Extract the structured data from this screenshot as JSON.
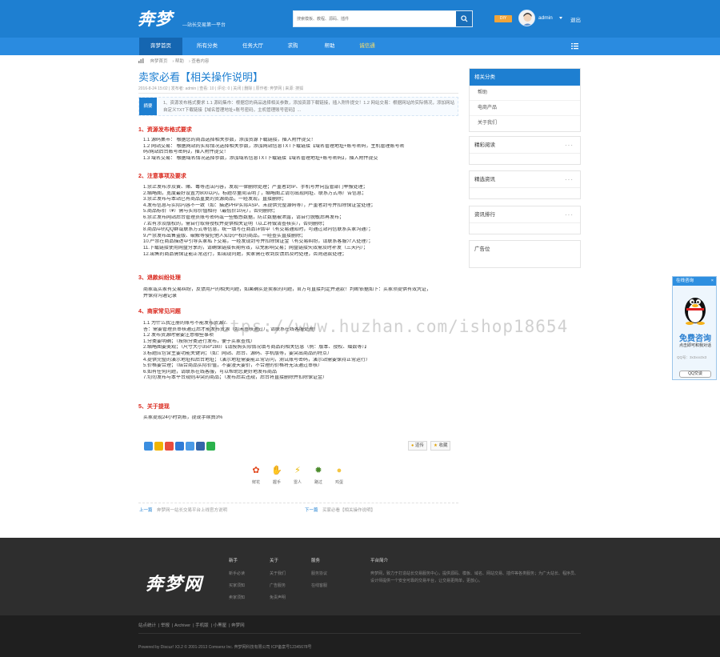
{
  "header": {
    "logo_text": "奔梦",
    "slogan": "—站长交易第一平台",
    "search_placeholder": "搜索模板、教程、源码、插件",
    "diy_badge": "DIY",
    "username": "admin",
    "logout": "退出"
  },
  "nav": {
    "items": [
      "奔梦首页",
      "所有分类",
      "任务大厅",
      "求购",
      "帮助",
      "诚信通"
    ]
  },
  "breadcrumb": [
    "奔梦首页",
    "帮助",
    "查看内容"
  ],
  "article": {
    "title": "卖家必看【相关操作说明】",
    "meta": "2016-8-24 15:02 | 发布者: admin | 查看: 10 | 评论: 0 | 关闭 | 删除 | 原作者: 奔梦网 | 来源: 搜狐",
    "abstract_tag": "摘要",
    "abstract": "1、资源发布格式要求 1.1 源码集市：根据您的商品选择相关参数，添加资源下载链接，插入附件提交！1.2 网站交易：根据网站的实际情况，添加网站自定义TXT下载链接【域名管理地址+账号密码，主机管理账号密码】...",
    "sections": [
      {
        "heading": "1、资源发布格式要求",
        "lines": [
          "1.1 源码集市：  根据您的商品选择相关参数，添加资源下载链接，插入附件提交！",
          "1.2 网站交易：  根据网站的实际情况选择相关参数，添加网站信息TXT下载链接【域名管理地址+账号密码，主机管理账号密",
          "码/网站后台账号密码】，插入附件提交！",
          "1.3 域名交易：  根据域名情况选择参数，添加域名信息TXT下载链接【域名管理地址+账号密码】，插入附件提交"
        ]
      },
      {
        "heading": "2、注意事项及要求",
        "lines": [
          "1.禁止发布涉及黄、赌、毒等违法内容，发现一律删除处理；严重者封IP、手机号并向监管部门举报处理；",
          "2.缩略图，宽度最好设置为800以内，标题尽量简洁明了，缩略图上请勿出现网址、联系方式等广告信息；",
          "3.禁止发布与本站已有商品重复的资源商品，一经发现，直接删除；",
          "4.发布信息与实际内容不一致（如：描述PHP实际ASP、未提供完整源码等），严重者封号并扣除保证金处理；",
          "5.商品标价（¥）需与实际价值相符（最低价10元），否则删除；",
          "6.禁止发布网站后台管理员账号密码或一些敏感数据，防止数据被泄露，请自行脱敏后再发布；",
          "7.若有涉及版权的，需自行取得授权并提供相关证明（以上将做清查核实），否则删除；",
          "8.商品中的QQ群或联系方式等信息，统一填写在商品详情中（有交易通知时，可通过站内信联系买家沟通）；",
          "9.严禁发布出售盗版、破解等侵犯他人知识产权的商品，一经查实直接删除；",
          "10.严禁在商品描述中引导买家私下交易，一经发现封号并扣除保证金（有交易纠纷，请联系客服介入处理）；",
          "11.下载链接使用网盘分享的，请确保链接长期有效，以免影响交易；网盘链接失效需及时补发（三天内）；",
          "12.出售的商品需保证能正常运行，如出现问题，卖家需在收到反馈后及时处理，否则退款处理；"
        ]
      },
      {
        "heading": "3、退款纠纷处理",
        "lines": [
          "商家或买家有交易纠纷，反馈用户的相关问题，如果确实是卖家的问题，官方可直接判定并退款！判断依据如下：买家须提供有效凭证，",
          "并保持沟通记录"
        ]
      },
      {
        "heading": "4、商家常见问题",
        "lines": [
          "1.1 为什么我注册的账号不能发布资源？",
          "答：需要管理员审核通过后才能发布资源（如未审核通过），请联系在线客服处理！",
          "",
          "1.2 发布资源时需要注意哪些事项",
          "1.分类要明确；（按照分类进行发布，便于买家查找）",
          "2.缩略图要美观；（尺寸大小350*280）【请按照实际情况填写商品的相关信息（例：版本、授权、赠数等）】",
          "3.标题应包含主要功能关键词；（如：网站、后台、源码、手机版等，要突出商品的特点）",
          "4.提供完整的演示地址和后台地址；（演示地址需要能正常访问，测试账号密码，演示站需要保持正常运行）",
          "5.价格要合理；（结合商品实际价值，不要漫天要价，不合理的价格将无法通过审核）",
          "6.如有任何问题，请联系在线客服，可以帮助您更好地发布商品",
          "7.切勿发布与本平台规则冲突的商品；（发布后若违规，后台将直接删除并扣除保证金）"
        ]
      },
      {
        "heading": "5、关于提现",
        "lines": [
          "买家提现24小时到账，提现手续费3%"
        ]
      }
    ],
    "actions": [
      "道传",
      "收藏"
    ],
    "moods": [
      {
        "icon": "flower-icon",
        "glyph": "✿",
        "label": "鲜花",
        "color": "#e2471c"
      },
      {
        "icon": "handshake-icon",
        "glyph": "✋",
        "label": "握手",
        "color": "#e0a33c"
      },
      {
        "icon": "lightning-icon",
        "glyph": "⚡",
        "label": "雷人",
        "color": "#e8b700"
      },
      {
        "icon": "bomb-icon",
        "glyph": "✹",
        "label": "路过",
        "color": "#4a8a2a"
      },
      {
        "icon": "egg-icon",
        "glyph": "●",
        "label": "鸡蛋",
        "color": "#f4c542"
      }
    ],
    "prev": {
      "label": "上一篇",
      "text": "奔梦网一站长交易平台上线官方说明"
    },
    "next": {
      "label": "下一篇",
      "text": "买家必看【相关操作说明】"
    }
  },
  "sidebar": {
    "category": {
      "title": "相关分类",
      "items": [
        "帮助",
        "电商产品",
        "关于我们"
      ]
    },
    "boxes": [
      "精彩阅读",
      "精选资讯",
      "资讯排行",
      "广告位"
    ]
  },
  "qq_float": {
    "header": "在线咨询",
    "close": "×",
    "title": "免费咨询",
    "subtitle": "点击即可和我对话",
    "number": "QQ号：3x3xxx3x3",
    "button": "QQ交谈"
  },
  "watermark": "https://www.huzhan.com/ishop18654",
  "footer": {
    "logo": "奔梦网",
    "cols": [
      {
        "title": "新手",
        "links": [
          "新手必读",
          "买家须知",
          "卖家须知"
        ]
      },
      {
        "title": "关于",
        "links": [
          "关于我们",
          "广告服务",
          "免责声明"
        ]
      },
      {
        "title": "服务",
        "links": [
          "服务协议",
          "在线客服"
        ]
      }
    ],
    "about_title": "平台简介",
    "about": "奔梦网，致力于打造站长交易服务中心，提供源码、模板、域名、网站交易、插件等各类服务；为广大站长、程序员、设计师提供一个安全可靠的交易平台，让交易更简单，更放心。"
  },
  "bottom": {
    "links": [
      "站点统计",
      "举报",
      "Archiver",
      "手机版",
      "小黑屋",
      "奔梦网"
    ],
    "copyright": "Powered by Discuz! X3.2  © 2001-2013 Comsenz Inc.  奔梦网科技有限公司  ICP备案号12345678号"
  }
}
